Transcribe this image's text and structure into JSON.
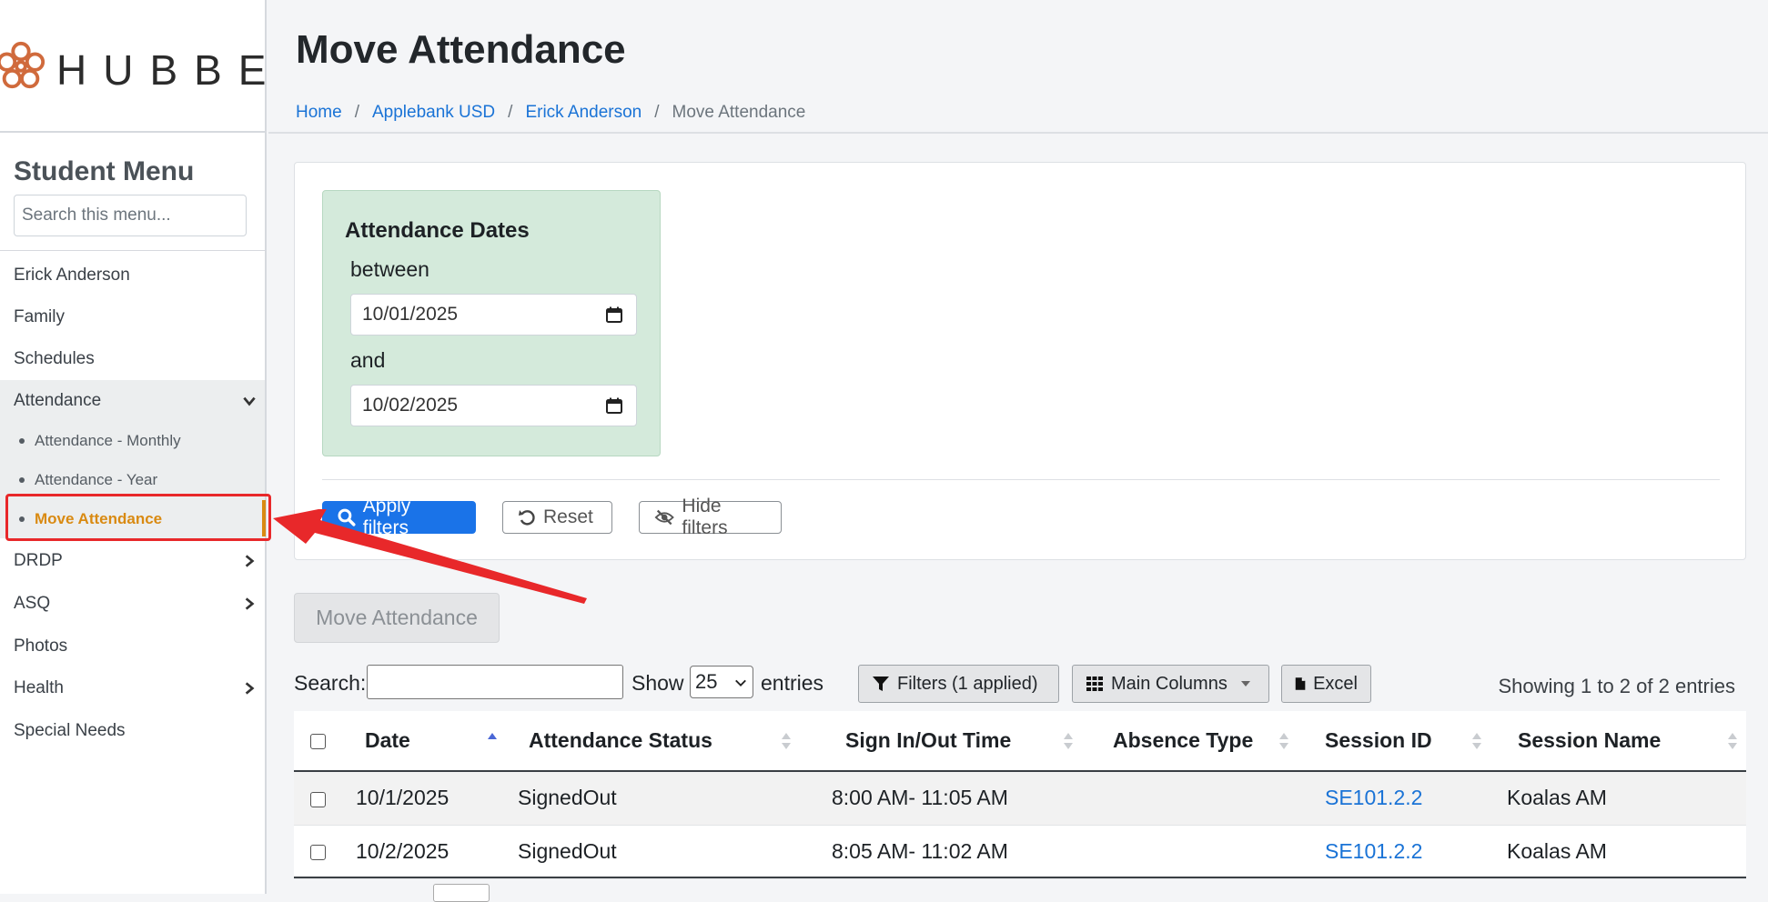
{
  "brand": {
    "logo_text": "HUBBE",
    "logo_color": "#d06a3c"
  },
  "sidebar": {
    "title": "Student Menu",
    "search_placeholder": "Search this menu...",
    "items": [
      {
        "label": "Erick Anderson"
      },
      {
        "label": "Family"
      },
      {
        "label": "Schedules"
      },
      {
        "label": "Attendance",
        "expanded": true,
        "icon": "chevron-down-icon"
      },
      {
        "label": "DRDP",
        "icon": "chevron-right-icon"
      },
      {
        "label": "ASQ",
        "icon": "chevron-right-icon"
      },
      {
        "label": "Photos"
      },
      {
        "label": "Health",
        "icon": "chevron-right-icon"
      },
      {
        "label": "Special Needs"
      }
    ],
    "attendance_sub": [
      {
        "label": "Attendance - Monthly"
      },
      {
        "label": "Attendance - Year"
      },
      {
        "label": "Move Attendance",
        "active": true
      }
    ],
    "active_color": "#d98a12"
  },
  "header": {
    "title": "Move Attendance",
    "breadcrumb": [
      "Home",
      "Applebank USD",
      "Erick Anderson",
      "Move Attendance"
    ]
  },
  "filters": {
    "box_title": "Attendance Dates",
    "between_label": "between",
    "and_label": "and",
    "start_date": "10/01/2025",
    "end_date": "10/02/2025",
    "apply_label": "Apply filters",
    "reset_label": "Reset",
    "hide_label": "Hide filters",
    "apply_color": "#1a73e8"
  },
  "move_button_label": "Move Attendance",
  "table_controls": {
    "search_label": "Search:",
    "search_value": "",
    "show_label": "Show",
    "page_size": "25",
    "entries_label": "entries",
    "filters_label": "Filters (1 applied)",
    "columns_label": "Main Columns",
    "excel_label": "Excel",
    "showing_text": "Showing 1 to 2 of 2 entries"
  },
  "table": {
    "columns": [
      "Date",
      "Attendance Status",
      "Sign In/Out Time",
      "Absence Type",
      "Session ID",
      "Session Name"
    ],
    "rows": [
      {
        "date": "10/1/2025",
        "status": "SignedOut",
        "time": "8:00 AM- 11:05 AM",
        "absence": "",
        "session_id": "SE101.2.2",
        "session_name": "Koalas AM"
      },
      {
        "date": "10/2/2025",
        "status": "SignedOut",
        "time": "8:05 AM- 11:02 AM",
        "absence": "",
        "session_id": "SE101.2.2",
        "session_name": "Koalas AM"
      }
    ],
    "link_color": "#1a73d6"
  },
  "annotation": {
    "color": "#e8282a",
    "target": "Move Attendance"
  }
}
